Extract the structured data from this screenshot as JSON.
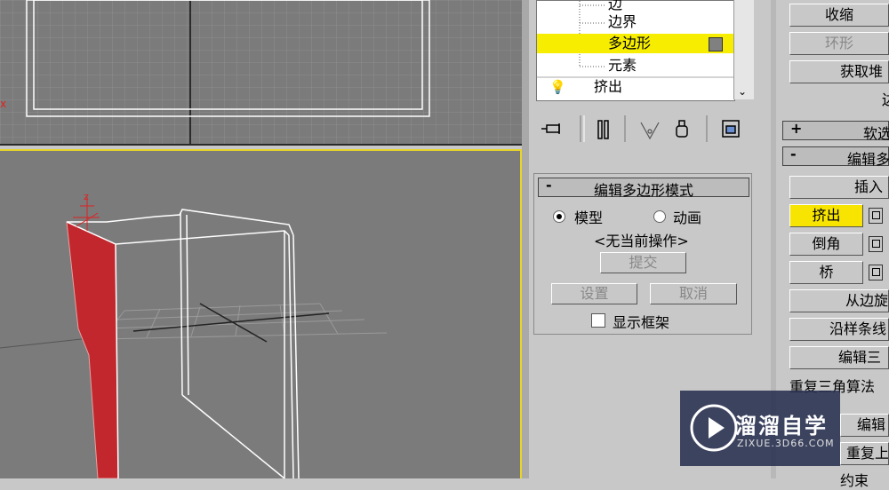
{
  "tree": {
    "items": [
      {
        "label": "边"
      },
      {
        "label": "边界"
      },
      {
        "label": "多边形",
        "selected": true
      },
      {
        "label": "元素"
      },
      {
        "label": "挤出"
      }
    ]
  },
  "toolbar": {
    "icons": [
      "pin-stack-icon",
      "show-end-result-icon",
      "make-unique-icon",
      "remove-modifier-icon",
      "configure-sets-icon"
    ]
  },
  "edit_poly_mode": {
    "title": "编辑多边形模式",
    "collapse_symbol": "-",
    "radio_model": "模型",
    "radio_animate": "动画",
    "status": "<无当前操作>",
    "commit": "提交",
    "settings": "设置",
    "cancel": "取消",
    "show_cage": "显示框架"
  },
  "right_panel": {
    "collapse_btn": "收缩",
    "ring_btn": "环形",
    "get_stack_btn": "获取堆",
    "clipped_char": "边",
    "soft_rollout": {
      "symbol": "+",
      "title": "软选"
    },
    "edit_rollout": {
      "symbol": "-",
      "title": "编辑多"
    },
    "insert_btn": "插入",
    "extrude_btn": "挤出",
    "bevel_btn": "倒角",
    "bridge_btn": "桥",
    "from_edge_btn": "从边旋",
    "along_spline_btn": "沿样条线",
    "edit_tri_btn": "编辑三",
    "retriangulate_btn": "重复三角算法",
    "edit_btn": "编辑",
    "repeat_btn": "重复上",
    "constraint_btn": "约束"
  },
  "watermark": {
    "name": "溜溜自学",
    "url": "ZIXUE.3D66.COM"
  },
  "colors": {
    "viewport_bg": "#7b7b7b",
    "selection_yellow": "#f7ed00",
    "active_viewport_border": "#e9d42a",
    "face_red": "#c1272d"
  }
}
